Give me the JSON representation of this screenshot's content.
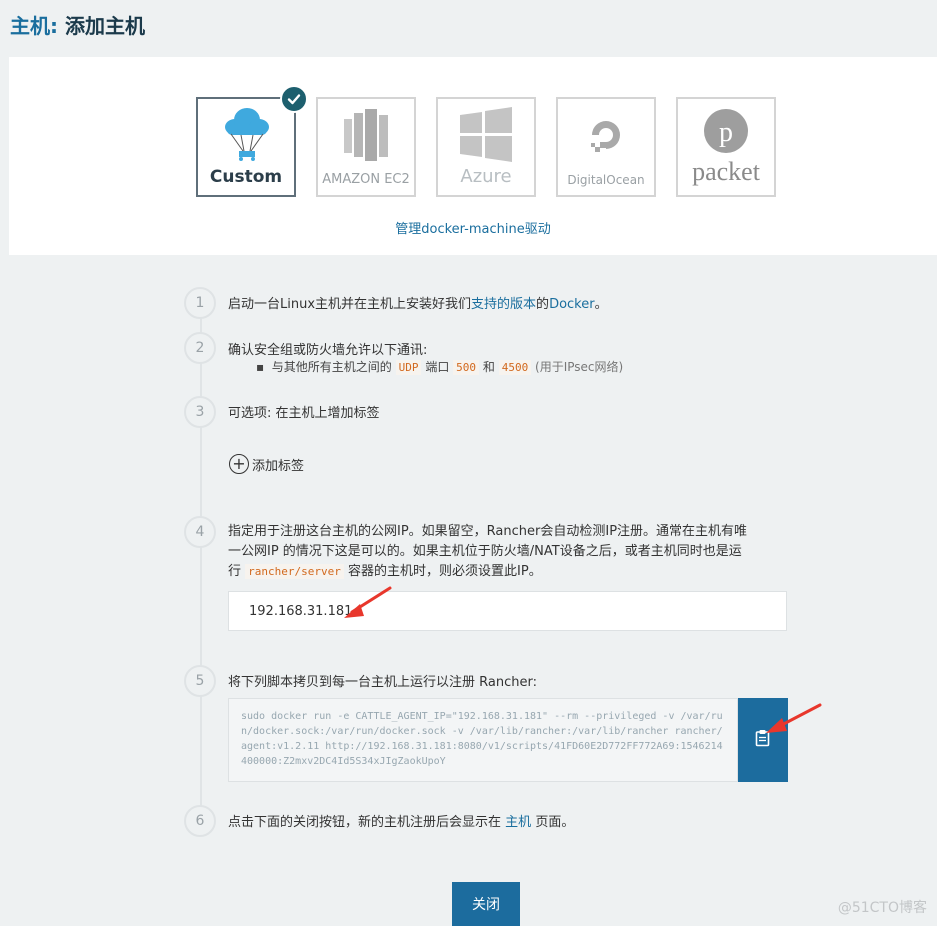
{
  "header": {
    "title_prefix": "主机",
    "title_separator": ":",
    "title_main": " 添加主机"
  },
  "drivers": {
    "items": [
      {
        "label": "Custom",
        "selected": true
      },
      {
        "label": "AMAZON EC2",
        "selected": false
      },
      {
        "label": "Azure",
        "selected": false
      },
      {
        "label": "DigitalOcean",
        "selected": false
      },
      {
        "label": "packet",
        "selected": false
      }
    ],
    "manage_link": "管理docker-machine驱动"
  },
  "steps": {
    "s1": {
      "num": "1",
      "text_before": "启动一台Linux主机并在主机上安装好我们",
      "link_supported": "支持的版本",
      "text_mid": "的",
      "link_docker": "Docker",
      "text_end": "。"
    },
    "s2": {
      "num": "2",
      "text": "确认安全组或防火墙允许以下通讯:",
      "bullet_prefix": "与其他所有主机之间的",
      "proto": "UDP",
      "port_label": "端口",
      "port1": "500",
      "and_label": "和",
      "port2": "4500",
      "note": "(用于IPsec网络)"
    },
    "s3": {
      "num": "3",
      "text": "可选项: 在主机上增加标签",
      "add_label": "添加标签"
    },
    "s4": {
      "num": "4",
      "line1": "指定用于注册这台主机的公网IP。如果留空，Rancher会自动检测IP注册。通常在主机有唯",
      "line2": "一公网IP 的情况下这是可以的。如果主机位于防火墙/NAT设备之后，或者主机同时也是运",
      "line3_before": "行",
      "line3_code": "rancher/server",
      "line3_after": "容器的主机时，则必须设置此IP。",
      "ip_value": "192.168.31.181"
    },
    "s5": {
      "num": "5",
      "text": "将下列脚本拷贝到每一台主机上运行以注册 Rancher:",
      "script": "sudo docker run -e CATTLE_AGENT_IP=\"192.168.31.181\"  --rm --privileged -v /var/run/docker.sock:/var/run/docker.sock -v /var/lib/rancher:/var/lib/rancher rancher/agent:v1.2.11 http://192.168.31.181:8080/v1/scripts/41FD60E2D772FF772A69:1546214400000:Z2mxv2DC4Id5S34xJIgZaokUpoY"
    },
    "s6": {
      "num": "6",
      "text_before": "点击下面的关闭按钮，新的主机注册后会显示在",
      "link_hosts": "主机",
      "text_after": "页面。"
    }
  },
  "footer": {
    "close_label": "关闭",
    "watermark": "@51CTO博客"
  },
  "colors": {
    "accent": "#1c6c9e",
    "link": "#1a6e9e",
    "badge": "#1d5f6e",
    "arrow": "#e8372c"
  }
}
